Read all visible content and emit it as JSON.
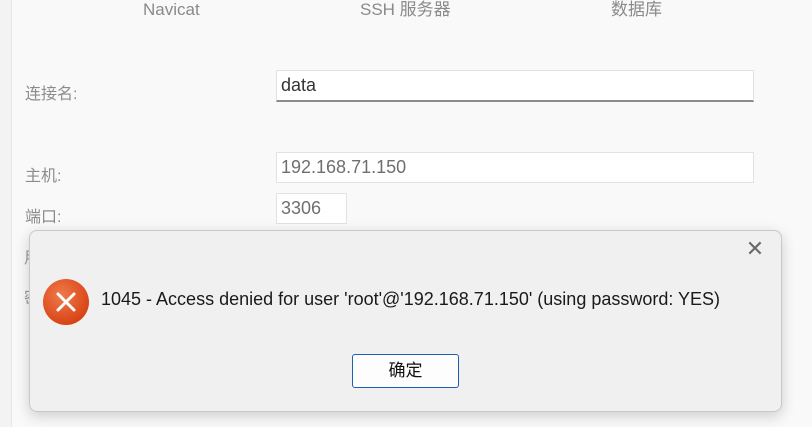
{
  "tabs": [
    {
      "label": "Navicat"
    },
    {
      "label": "SSH 服务器"
    },
    {
      "label": "数据库"
    }
  ],
  "form": {
    "connection_name_label": "连接名:",
    "connection_name_value": "data",
    "host_label": "主机:",
    "host_value": "192.168.71.150",
    "port_label": "端口:",
    "port_value": "3306",
    "partial_label_1": "用",
    "partial_label_2": "密"
  },
  "error_dialog": {
    "message": "1045 - Access denied for user 'root'@'192.168.71.150' (using password: YES)",
    "ok_label": "确定",
    "close_glyph": "✕",
    "icon": "error-circle-x-icon",
    "icon_color": "#e0502b"
  }
}
